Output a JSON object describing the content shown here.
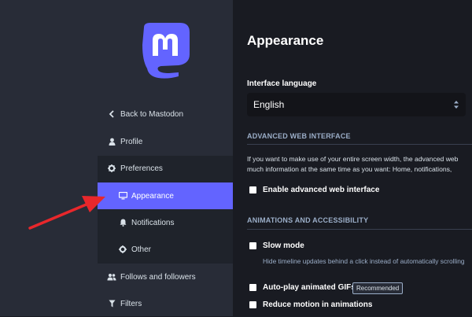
{
  "sidebar": {
    "logo_icon": "mastodon-logo",
    "items": [
      {
        "label": "Back to Mastodon",
        "icon": "chevron-left-icon"
      },
      {
        "label": "Profile",
        "icon": "user-icon"
      },
      {
        "label": "Preferences",
        "icon": "gear-icon"
      },
      {
        "label": "Appearance",
        "icon": "desktop-icon"
      },
      {
        "label": "Notifications",
        "icon": "bell-icon"
      },
      {
        "label": "Other",
        "icon": "gear-icon"
      },
      {
        "label": "Follows and followers",
        "icon": "users-icon"
      },
      {
        "label": "Filters",
        "icon": "filter-icon"
      }
    ]
  },
  "main": {
    "title": "Appearance",
    "interface_language": {
      "label": "Interface language",
      "value": "English"
    },
    "sections": {
      "advanced": "ADVANCED WEB INTERFACE",
      "animations": "ANIMATIONS AND ACCESSIBILITY"
    },
    "advanced_desc": [
      "If you want to make use of your entire screen width, the advanced web",
      "much information at the same time as you want: Home, notifications,"
    ],
    "options": {
      "advanced": "Enable advanced web interface",
      "slow_mode": "Slow mode",
      "slow_mode_hint": "Hide timeline updates behind a click instead of automatically scrolling",
      "autoplay": "Auto-play animated GIFs",
      "recommended": "Recommended",
      "reduce_motion": "Reduce motion in animations"
    }
  },
  "colors": {
    "accent": "#6364ff",
    "annotation_arrow": "#e8272b"
  }
}
